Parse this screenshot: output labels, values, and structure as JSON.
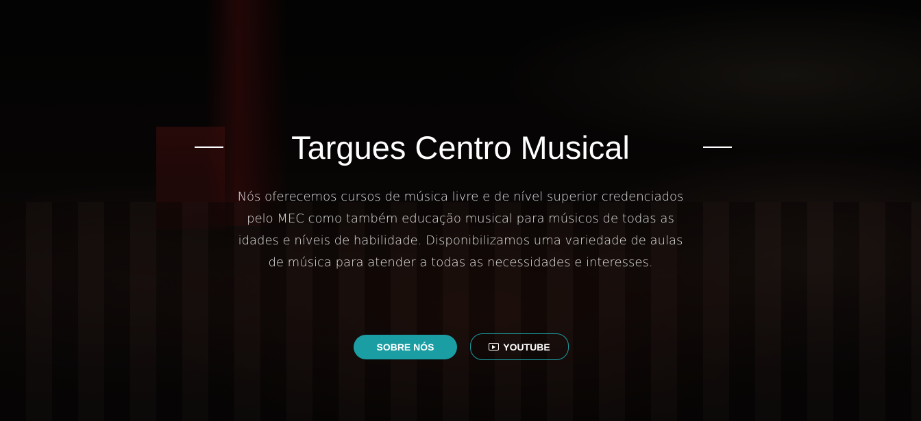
{
  "hero": {
    "title": "Targues Centro Musical",
    "description": "Nós oferecemos cursos de música livre e de nível superior credenciados pelo MEC como também educação musical para músicos de todas as idades e níveis de habilidade. Disponibilizamos uma variedade de aulas de música para atender a todas as necessidades e interesses.",
    "buttons": {
      "about_label": "SOBRE NÓS",
      "youtube_label": "YOUTUBE",
      "youtube_icon": "play-icon"
    }
  },
  "colors": {
    "accent": "#1a9ea3",
    "text": "#ffffff"
  }
}
